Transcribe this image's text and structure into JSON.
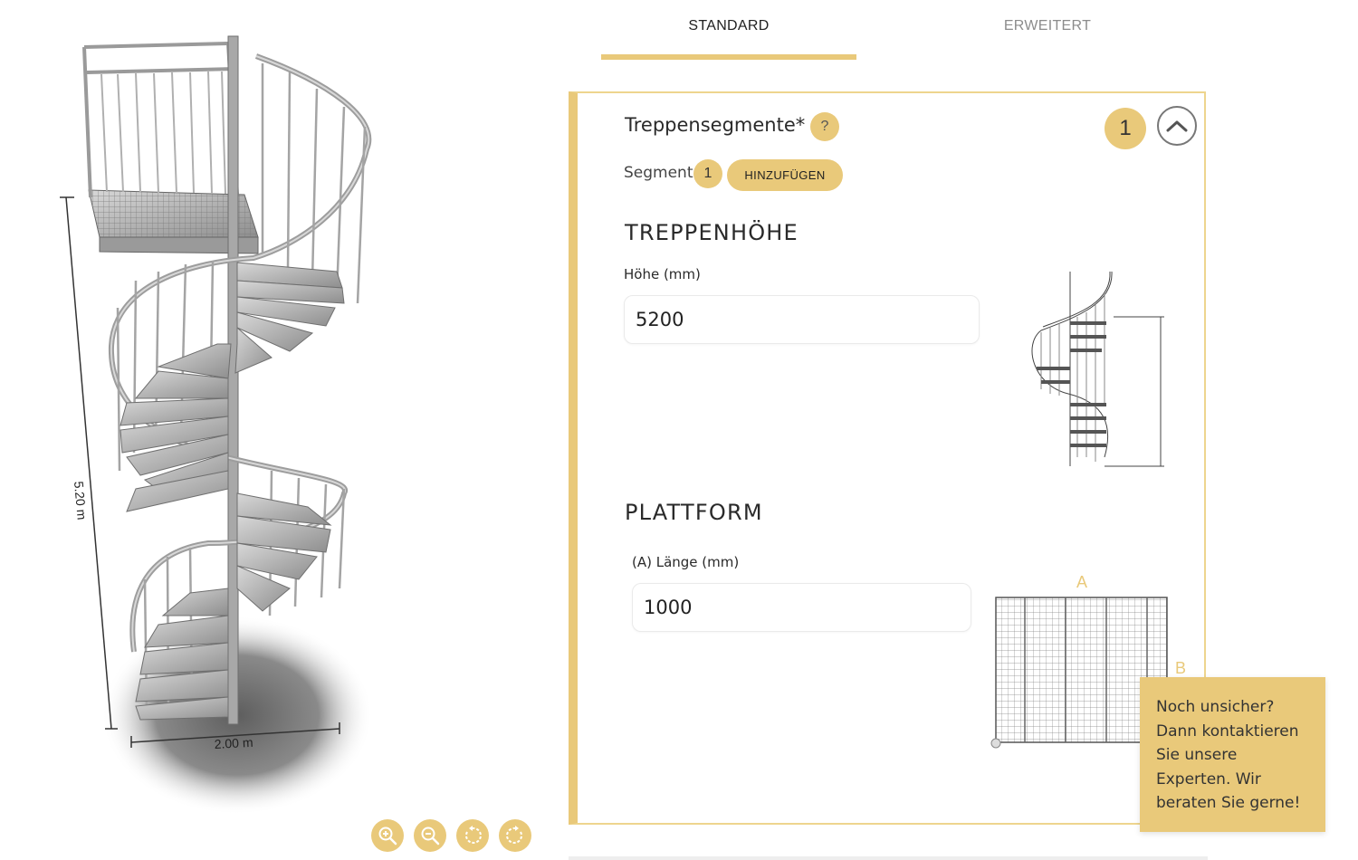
{
  "viewer": {
    "height_dimension": "5.20 m",
    "width_dimension": "2.00 m",
    "tools": [
      {
        "name": "zoom-in-icon"
      },
      {
        "name": "zoom-out-icon"
      },
      {
        "name": "rotate-left-icon"
      },
      {
        "name": "rotate-right-icon"
      }
    ]
  },
  "tabs": {
    "standard": "STANDARD",
    "erweitert": "ERWEITERT",
    "active": "standard"
  },
  "segments": {
    "title": "Treppensegmente*",
    "help": "?",
    "count": "1",
    "segment_label": "Segment",
    "segment_number": "1",
    "add_button": "HINZUFÜGEN"
  },
  "height_section": {
    "title": "TREPPENHÖHE",
    "label": "Höhe (mm)",
    "value": "5200"
  },
  "platform_section": {
    "title": "PLATTFORM",
    "label": "(A) Länge (mm)",
    "value": "1000",
    "letter_a": "A",
    "letter_b": "B"
  },
  "contact": {
    "text": "Noch unsicher? Dann kontaktieren Sie unsere Experten. Wir beraten Sie gerne!"
  },
  "colors": {
    "accent": "#e9c97a",
    "border": "#eed58e",
    "text": "#2a2a2a",
    "muted": "#8c8c8c"
  }
}
